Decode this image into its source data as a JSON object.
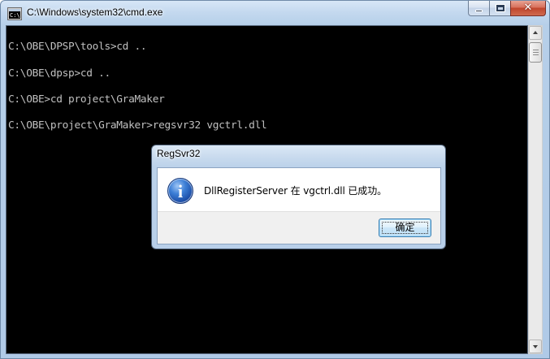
{
  "window": {
    "title": "C:\\Windows\\system32\\cmd.exe",
    "icon": "C:\\"
  },
  "console": {
    "lines": [
      "C:\\OBE\\DPSP\\tools>cd ..",
      "C:\\OBE\\dpsp>cd ..",
      "C:\\OBE>cd project\\GraMaker",
      "C:\\OBE\\project\\GraMaker>regsvr32 vgctrl.dll"
    ]
  },
  "dialog": {
    "title": "RegSvr32",
    "message": "DllRegisterServer 在 vgctrl.dll 已成功。",
    "icon": "i",
    "ok_label": "确定"
  },
  "colors": {
    "console_bg": "#000000",
    "console_fg": "#c0c0c0",
    "close_button": "#c75050"
  }
}
